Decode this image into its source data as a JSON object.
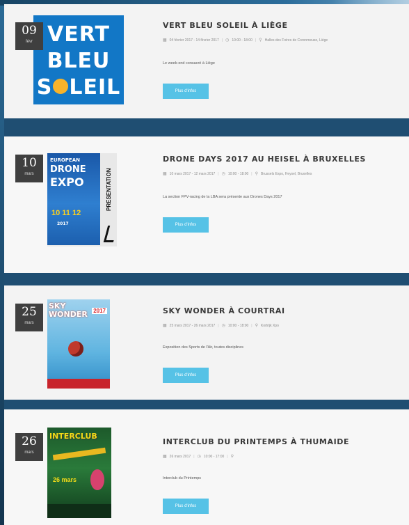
{
  "events": [
    {
      "day": "09",
      "month": "févr",
      "title": "VERT BLEU SOLEIL À LIÈGE",
      "date_text": "04 février 2017 - 14 février 2017",
      "time_text": "10:00 - 18:00",
      "location_text": "Halles des Foires de Coronmeuse, Liège",
      "description": "Le week-end consacré à Liège",
      "button_label": "Plus d'infos",
      "poster": {
        "line1": "VERT",
        "line2": "BLEU",
        "line3a": "S",
        "line3b": "LEIL"
      }
    },
    {
      "day": "10",
      "month": "mars",
      "title": "DRONE DAYS 2017 AU HEISEL À BRUXELLES",
      "date_text": "10 mars 2017 - 12 mars 2017",
      "time_text": "10:00 - 18:00",
      "location_text": "Brussels Expo, Heysel, Bruxelles",
      "description": "La section FPV-racing de la LBA sera présente aux Drones Days 2017",
      "button_label": "Plus d'infos",
      "poster": {
        "line1": "EUROPEAN",
        "line2": "DRONE",
        "line3": "EXPO",
        "dates": "10 11 12",
        "year": "2017",
        "side": "PRESENTATION"
      }
    },
    {
      "day": "25",
      "month": "mars",
      "title": "SKY WONDER À COURTRAI",
      "date_text": "25 mars 2017 - 26 mars 2017",
      "time_text": "10:00 - 18:00",
      "location_text": "Kortrijk Xpo",
      "description": "Exposition des Sports de l'Air, toutes disciplines",
      "button_label": "Plus d'infos",
      "poster": {
        "line1": "SKY",
        "line2": "WONDER",
        "year": "2017"
      }
    },
    {
      "day": "26",
      "month": "mars",
      "title": "INTERCLUB DU PRINTEMPS À THUMAIDE",
      "date_text": "26 mars 2017",
      "time_text": "10:00 - 17:00",
      "location_text": "",
      "description": "Interclub du Printemps",
      "button_label": "Plus d'infos",
      "poster": {
        "line1": "INTERCLUB",
        "dates": "26 mars"
      }
    }
  ],
  "icons": {
    "date": "calendar-icon",
    "time": "clock-icon",
    "location": "map-pin-icon"
  },
  "colors": {
    "button": "#56c2e6",
    "badge": "#3f3f3f",
    "title": "#3a3a3a",
    "background": "#1f4e72"
  }
}
